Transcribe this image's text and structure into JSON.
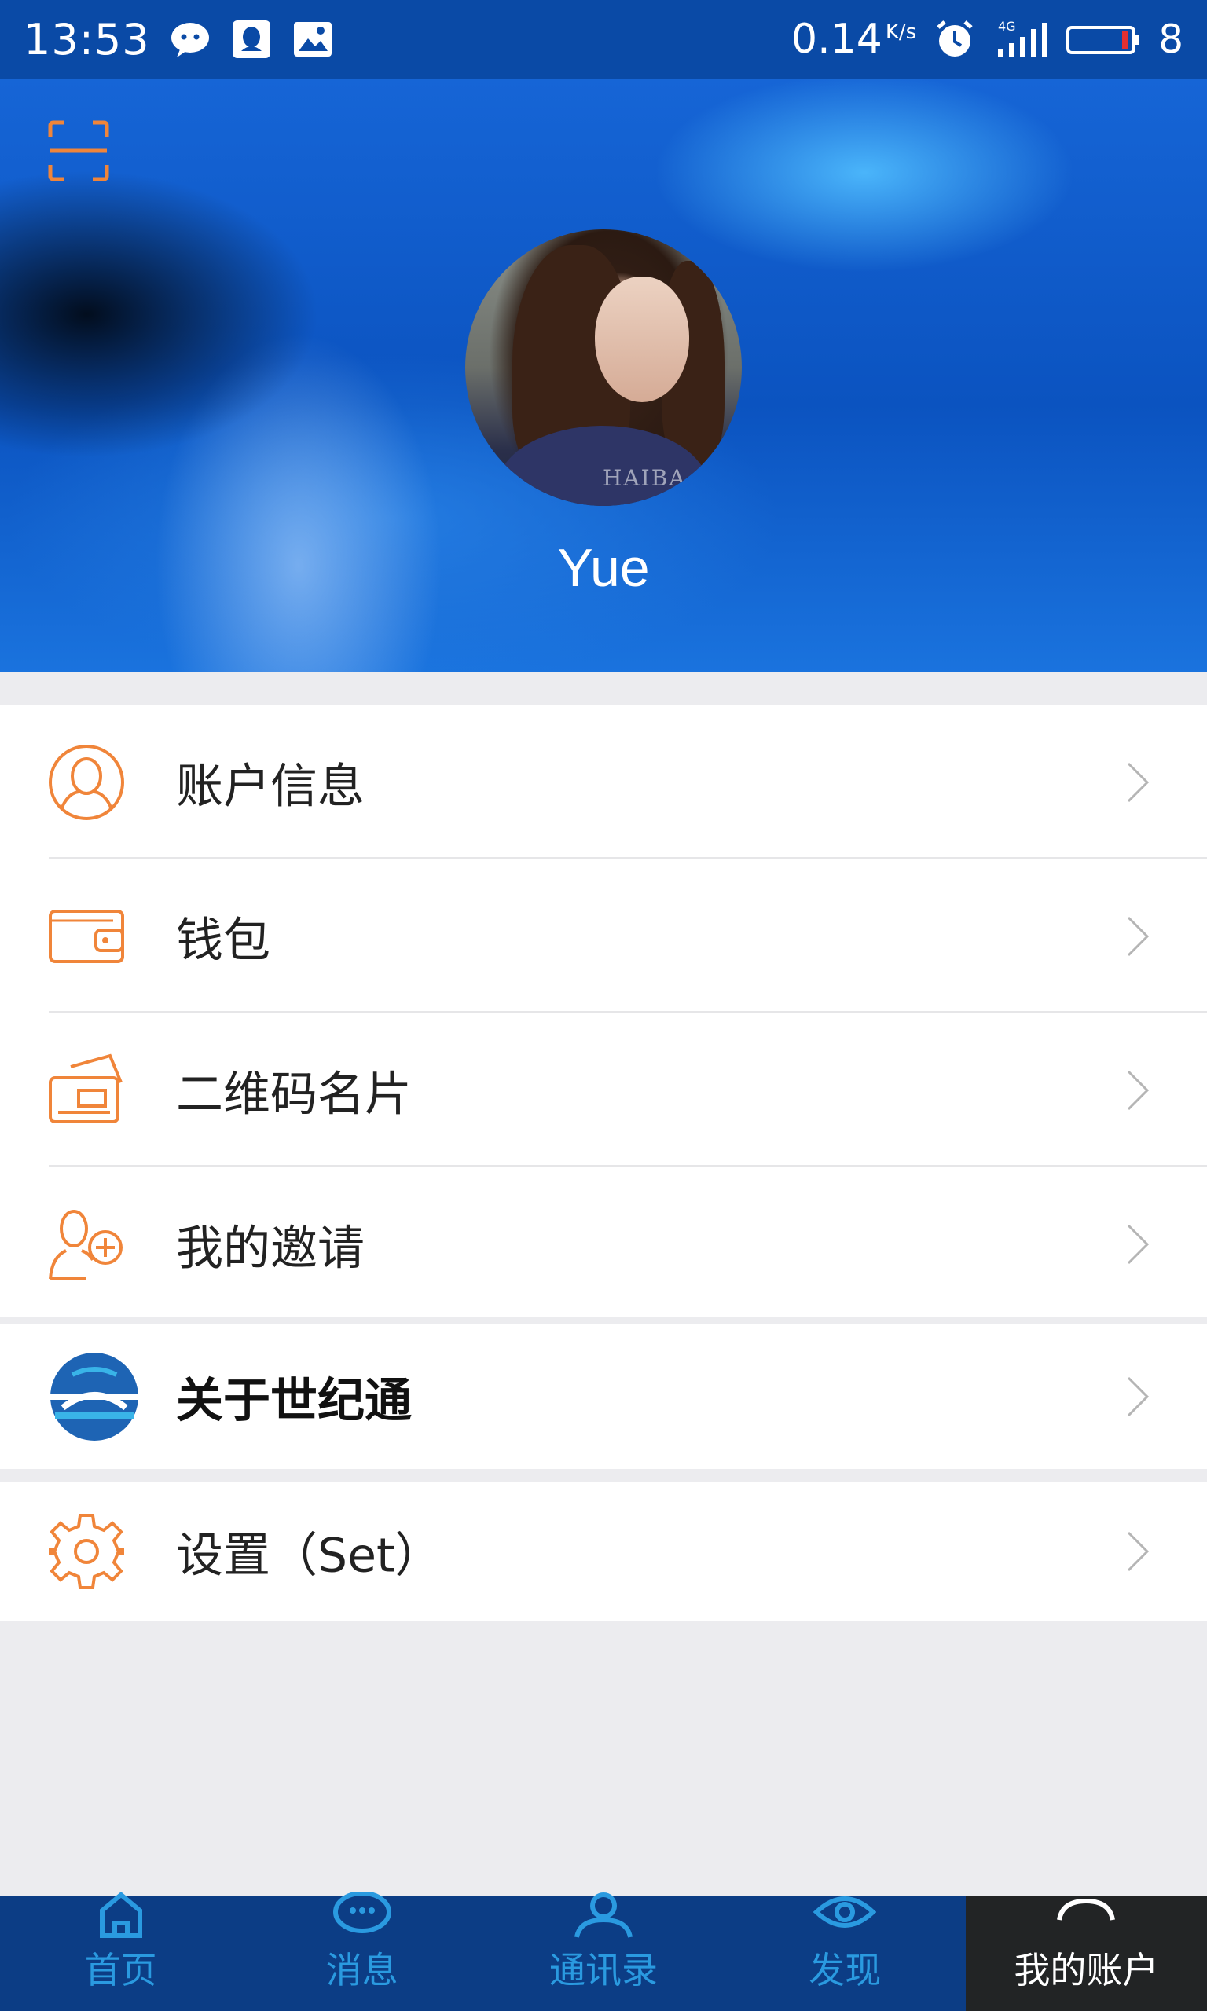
{
  "status_bar": {
    "time": "13:53",
    "network_speed": "0.14",
    "network_speed_unit": "K/s",
    "network_type": "4G",
    "battery_level": "8",
    "notification_icons": [
      "wechat-icon",
      "qq-icon",
      "gallery-icon"
    ],
    "system_icons": [
      "alarm-icon",
      "signal-icon",
      "battery-icon"
    ]
  },
  "header": {
    "scan_icon": "scan-icon",
    "avatar_watermark": "HAIBA",
    "username": "Yue"
  },
  "menu": {
    "items": [
      {
        "label": "账户信息",
        "icon": "account-info-icon"
      },
      {
        "label": "钱包",
        "icon": "wallet-icon"
      },
      {
        "label": "二维码名片",
        "icon": "qr-card-icon"
      },
      {
        "label": "我的邀请",
        "icon": "invite-user-icon"
      },
      {
        "label": "关于世纪通",
        "icon": "app-logo-icon"
      },
      {
        "label": "设置（Set）",
        "icon": "gear-icon"
      }
    ]
  },
  "bottom_nav": {
    "items": [
      {
        "label": "首页",
        "icon": "home-icon"
      },
      {
        "label": "消息",
        "icon": "message-icon"
      },
      {
        "label": "通讯录",
        "icon": "contacts-icon"
      },
      {
        "label": "发现",
        "icon": "discover-icon"
      },
      {
        "label": "我的账户",
        "icon": "account-icon"
      }
    ],
    "active_index": 4
  },
  "colors": {
    "accent_orange": "#f0853a",
    "header_blue": "#0b53c0",
    "status_bar_blue": "#0a4aa6",
    "nav_blue": "#0c3d85",
    "nav_label_blue": "#2a9ae0",
    "nav_active_bg": "#222425"
  }
}
